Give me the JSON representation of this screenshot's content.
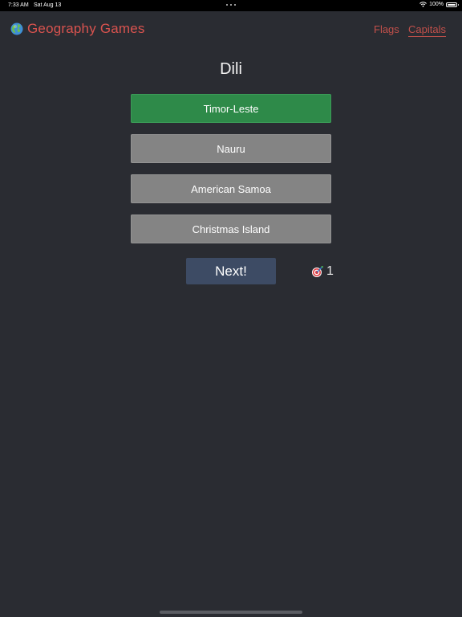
{
  "status_bar": {
    "time": "7:33 AM",
    "date": "Sat Aug 13",
    "battery": "100%"
  },
  "header": {
    "title": "Geography Games",
    "nav": {
      "flags": "Flags",
      "capitals": "Capitals"
    }
  },
  "quiz": {
    "question": "Dili",
    "answers": [
      {
        "label": "Timor-Leste",
        "state": "correct"
      },
      {
        "label": "Nauru",
        "state": "neutral"
      },
      {
        "label": "American Samoa",
        "state": "neutral"
      },
      {
        "label": "Christmas Island",
        "state": "neutral"
      }
    ],
    "next_label": "Next!",
    "score": "1"
  },
  "colors": {
    "background": "#2a2c32",
    "accent": "#d9534f",
    "correct": "#2e8a49",
    "neutral": "#848484",
    "next_button": "#3d4b64"
  },
  "icons": {
    "app": "globe-icon",
    "score": "target-icon",
    "wifi": "wifi-icon",
    "battery": "battery-icon"
  }
}
